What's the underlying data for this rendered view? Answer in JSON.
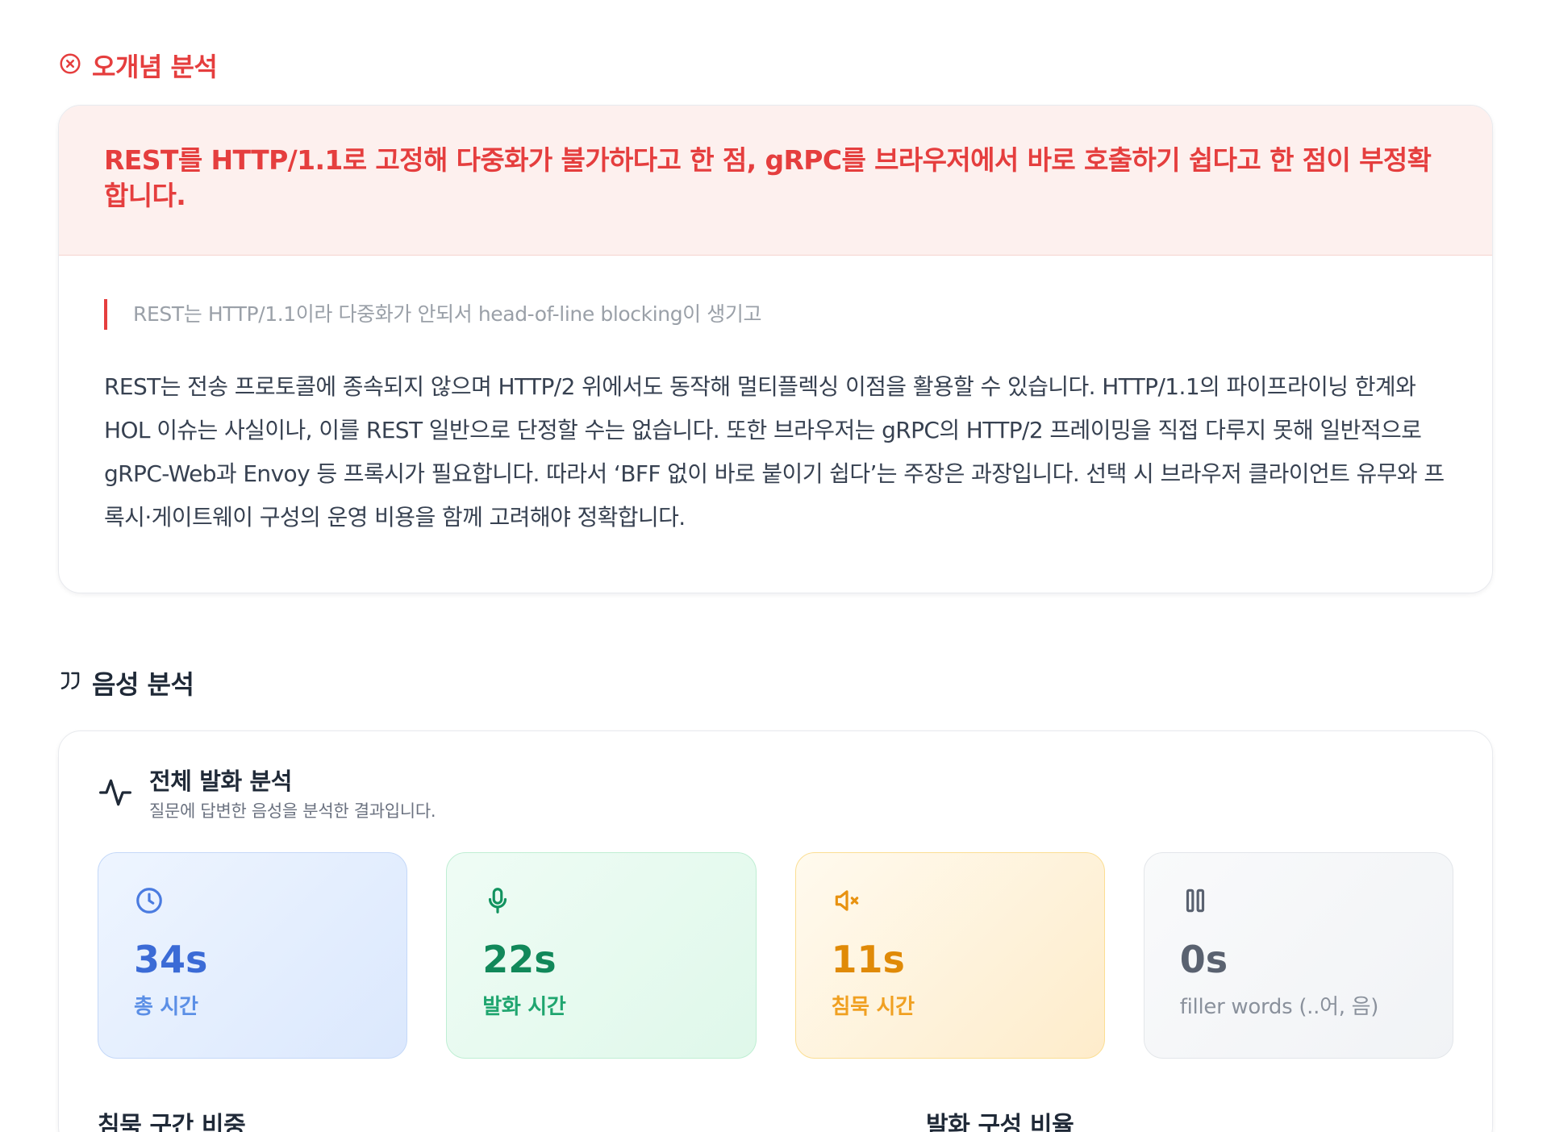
{
  "misconception": {
    "section_title": "오개념 분석",
    "summary": "REST를 HTTP/1.1로 고정해 다중화가 불가하다고 한 점, gRPC를 브라우저에서 바로 호출하기 쉽다고 한 점이 부정확합니다.",
    "quote": "REST는 HTTP/1.1이라 다중화가 안되서 head-of-line blocking이 생기고",
    "explanation": "REST는 전송 프로토콜에 종속되지 않으며 HTTP/2 위에서도 동작해 멀티플렉싱 이점을 활용할 수 있습니다. HTTP/1.1의 파이프라이닝 한계와 HOL 이슈는 사실이나, 이를 REST 일반으로 단정할 수는 없습니다. 또한 브라우저는 gRPC의 HTTP/2 프레이밍을 직접 다루지 못해 일반적으로 gRPC-Web과 Envoy 등 프록시가 필요합니다. 따라서 ‘BFF 없이 바로 붙이기 쉽다’는 주장은 과장입니다. 선택 시 브라우저 클라이언트 유무와 프록시·게이트웨이 구성의 운영 비용을 함께 고려해야 정확합니다.",
    "accent_color": "#e53e3e"
  },
  "voice": {
    "section_title": "음성 분석",
    "card_title": "전체 발화 분석",
    "card_subtitle": "질문에 답변한 음성을 분석한 결과입니다.",
    "stats": [
      {
        "value": "34s",
        "label": "총 시간",
        "icon": "clock-icon"
      },
      {
        "value": "22s",
        "label": "발화 시간",
        "icon": "microphone-icon"
      },
      {
        "value": "11s",
        "label": "침묵 시간",
        "icon": "speaker-muted-icon"
      },
      {
        "value": "0s",
        "label": "filler words (..어, 음)",
        "icon": "pause-icon"
      }
    ],
    "silence_ratio_title": "침묵 구간 비중",
    "speech_composition_title": "발화 구성 비율"
  }
}
